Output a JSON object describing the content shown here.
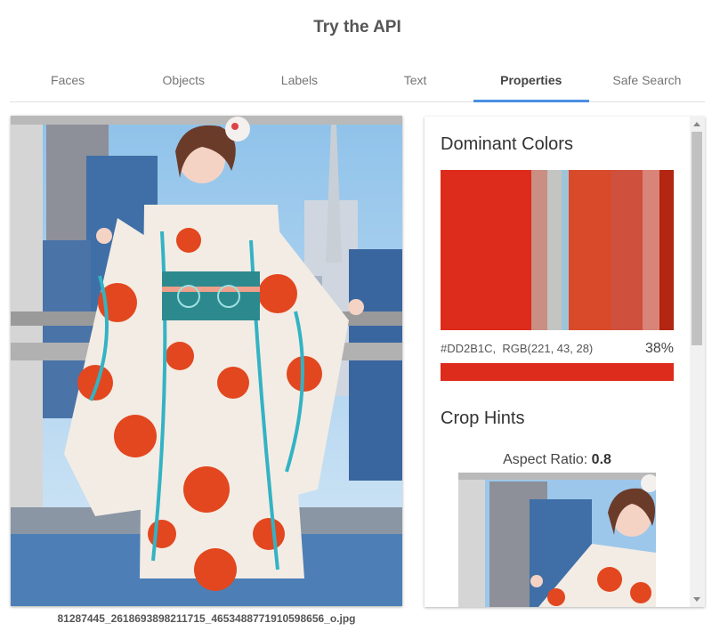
{
  "page": {
    "title": "Try the API"
  },
  "tabs": [
    {
      "label": "Faces",
      "active": false
    },
    {
      "label": "Objects",
      "active": false
    },
    {
      "label": "Labels",
      "active": false
    },
    {
      "label": "Text",
      "active": false
    },
    {
      "label": "Properties",
      "active": true
    },
    {
      "label": "Safe Search",
      "active": false
    }
  ],
  "image": {
    "filename": "81287445_2618693898211715_4653488771910598656_o.jpg"
  },
  "dominant_colors": {
    "title": "Dominant Colors",
    "swatches": [
      {
        "hex": "#DD2B1C",
        "share": 38
      },
      {
        "hex": "#C98F82",
        "share": 7
      },
      {
        "hex": "#C4C4C2",
        "share": 6
      },
      {
        "hex": "#9FC4D8",
        "share": 3
      },
      {
        "hex": "#D84A2A",
        "share": 18
      },
      {
        "hex": "#D0503E",
        "share": 13
      },
      {
        "hex": "#D88478",
        "share": 7
      },
      {
        "hex": "#B22612",
        "share": 6
      }
    ],
    "selected_hex": "#DD2B1C,",
    "selected_rgb": "RGB(221, 43, 28)",
    "selected_pct": "38%"
  },
  "crop_hints": {
    "title": "Crop Hints",
    "aspect_label": "Aspect Ratio:",
    "aspect_value": "0.8"
  }
}
